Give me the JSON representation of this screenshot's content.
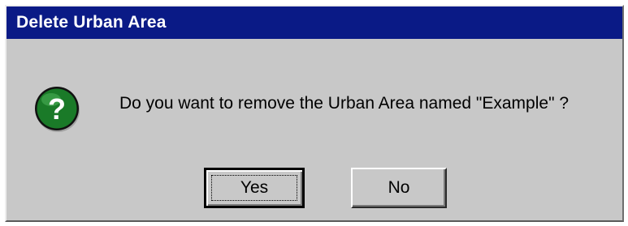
{
  "window": {
    "title": "Delete Urban Area"
  },
  "dialog": {
    "icon": "question-icon",
    "message": "Do you want to remove the Urban Area named \"Example\" ?",
    "buttons": {
      "yes_label": "Yes",
      "no_label": "No"
    }
  },
  "colors": {
    "titlebar": "#0a1a86",
    "dialog_background": "#c8c8c8",
    "icon_green": "#1a7a28"
  }
}
